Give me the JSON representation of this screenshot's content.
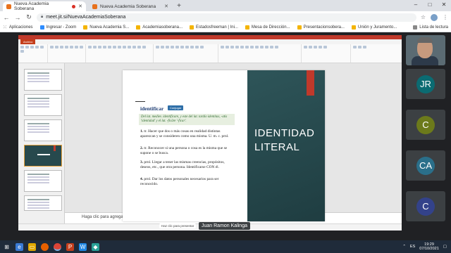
{
  "browser": {
    "tabs": [
      {
        "title": "Nueva Academia Soberana",
        "active": true
      },
      {
        "title": "Nueva Academia Soberana",
        "active": false
      }
    ],
    "new_tab": "+",
    "url": "meet.jit.si/NuevaAcademiaSoberana",
    "window_controls": [
      "–",
      "□",
      "✕"
    ]
  },
  "bookmarks": {
    "items": [
      {
        "label": "Aplicaciones",
        "icon": "apps-grid-icon"
      },
      {
        "label": "Ingresar - Zoom"
      },
      {
        "label": "Nueva Academia S..."
      },
      {
        "label": "Academiasoberana..."
      },
      {
        "label": "Estadosfreeman | Ini..."
      },
      {
        "label": "Mesa de Dirección..."
      },
      {
        "label": "Presentacionsobera..."
      },
      {
        "label": "Unión y Juramento..."
      }
    ],
    "reading_list": "Lista de lectura"
  },
  "slide": {
    "title_line1": "IDENTIDAD",
    "title_line2": "LITERAL",
    "dict_word": "identificar",
    "conjugate_button": "Conjugar",
    "etymology": "Del lat. mediev. identificare, y este del lat. tardío identitas, -atis 'identidad' y el lat. -ficāre '-ficar'.",
    "definitions": [
      {
        "n": "1.",
        "text": "tr. Hacer que dos o más cosas en realidad distintas aparezcan y se consideren como una misma. U. m. c. prnl."
      },
      {
        "n": "2.",
        "text": "tr. Reconocer si una persona o cosa es la misma que se supone o se busca."
      },
      {
        "n": "3.",
        "text": "prnl. Llegar a tener las mismas creencias, propósitos, deseos, etc., que otra persona. Identificarse CON él."
      },
      {
        "n": "4.",
        "text": "prnl. Dar los datos personales necesarios para ser reconocido."
      }
    ]
  },
  "ppt": {
    "notes_placeholder": "Haga clic para agregar notas",
    "file_tab": "Archivo"
  },
  "meeting": {
    "presenter_name": "Juan Ramon Kalinga",
    "presenting_hint": "Haz clic para presentar"
  },
  "participants": [
    {
      "type": "video"
    },
    {
      "initials": "JR",
      "color": "#0b6b72"
    },
    {
      "initials": "C",
      "color": "#6c7a1b"
    },
    {
      "initials": "CA",
      "color": "#2a6f8a"
    },
    {
      "initials": "C",
      "color": "#33428a"
    }
  ],
  "taskbar": {
    "language": "ES",
    "time": "19:29",
    "date": "07/10/2021"
  }
}
